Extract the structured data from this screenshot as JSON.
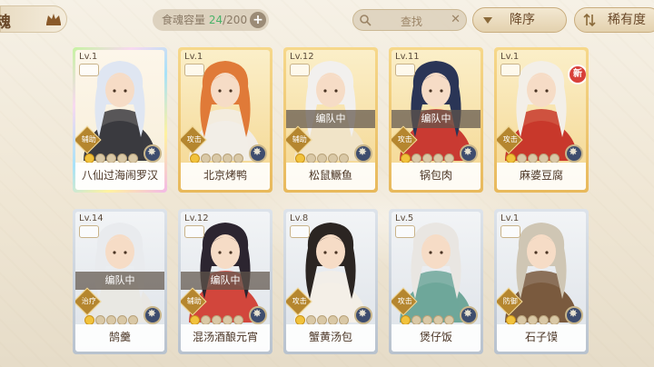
{
  "header": {
    "tab_label": "魂",
    "capacity_label": "食魂容量",
    "capacity_current": "24",
    "capacity_total": "/200",
    "capacity_add": "+",
    "search_placeholder": "查找",
    "search_clear": "✕",
    "sort_desc_label": "降序",
    "sort_rarity_label": "稀有度"
  },
  "cards": [
    {
      "level": "Lv.1",
      "name": "八仙过海闹罗汉",
      "role": "辅助",
      "stars_on": 1,
      "team": "",
      "frame": "rare",
      "new": false,
      "hair": "#dfe6f2",
      "robe": "#3b3b40"
    },
    {
      "level": "Lv.1",
      "name": "北京烤鸭",
      "role": "攻击",
      "stars_on": 1,
      "team": "",
      "frame": "gold",
      "new": false,
      "hair": "#e07a38",
      "robe": "#f2ede6"
    },
    {
      "level": "Lv.12",
      "name": "松鼠鳜鱼",
      "role": "辅助",
      "stars_on": 1,
      "team": "编队中",
      "frame": "gold",
      "new": false,
      "hair": "#f2f0ee",
      "robe": "#f1e4c8"
    },
    {
      "level": "Lv.11",
      "name": "锅包肉",
      "role": "攻击",
      "stars_on": 1,
      "team": "编队中",
      "frame": "gold",
      "new": false,
      "hair": "#2a3556",
      "robe": "#c93b32"
    },
    {
      "level": "Lv.1",
      "name": "麻婆豆腐",
      "role": "攻击",
      "stars_on": 1,
      "team": "",
      "frame": "gold",
      "new": true,
      "hair": "#f3efe8",
      "robe": "#c8382c"
    },
    {
      "level": "Lv.14",
      "name": "鹄羹",
      "role": "治疗",
      "stars_on": 1,
      "team": "编队中",
      "frame": "silver",
      "new": false,
      "hair": "#e9ebee",
      "robe": "#e9e7e3"
    },
    {
      "level": "Lv.12",
      "name": "混汤酒酿元宵",
      "role": "辅助",
      "stars_on": 1,
      "team": "编队中",
      "frame": "silver",
      "new": false,
      "hair": "#2c2530",
      "robe": "#d2463c"
    },
    {
      "level": "Lv.8",
      "name": "蟹黄汤包",
      "role": "攻击",
      "stars_on": 1,
      "team": "",
      "frame": "silver",
      "new": false,
      "hair": "#2b2522",
      "robe": "#f3efe6"
    },
    {
      "level": "Lv.5",
      "name": "煲仔饭",
      "role": "攻击",
      "stars_on": 1,
      "team": "",
      "frame": "silver",
      "new": false,
      "hair": "#e9e6e2",
      "robe": "#6fa79a"
    },
    {
      "level": "Lv.1",
      "name": "石子馍",
      "role": "防御",
      "stars_on": 1,
      "team": "",
      "frame": "silver",
      "new": false,
      "hair": "#cfc6b4",
      "robe": "#7a5a3e"
    }
  ],
  "icons": {
    "search": "magnifier-icon",
    "sort": "sort-down-icon",
    "rarity": "rarity-sort-icon",
    "crown": "crown-icon",
    "emblem": "emblem-icon"
  }
}
